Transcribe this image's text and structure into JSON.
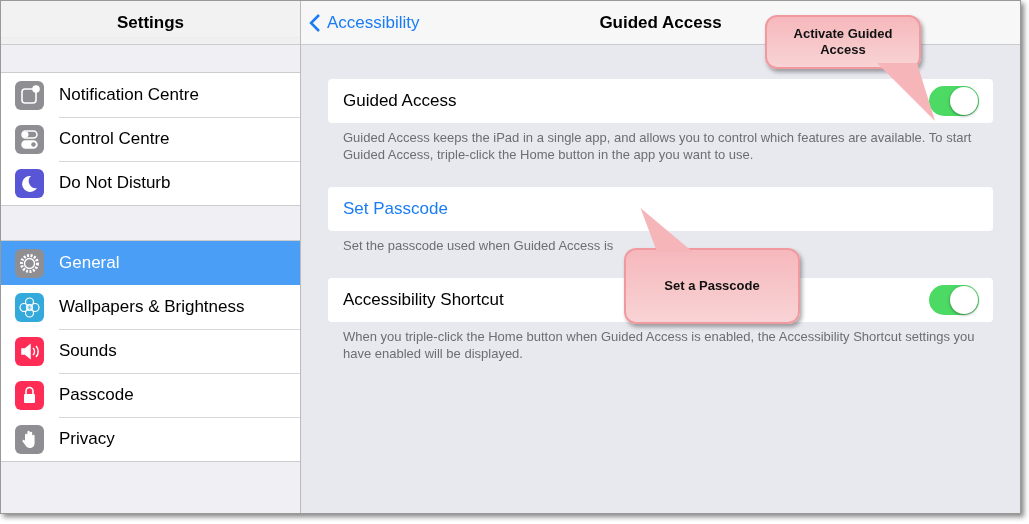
{
  "sidebar": {
    "title": "Settings",
    "groups": [
      [
        {
          "label": "Notification Centre",
          "selected": false
        },
        {
          "label": "Control Centre",
          "selected": false
        },
        {
          "label": "Do Not Disturb",
          "selected": false
        }
      ],
      [
        {
          "label": "General",
          "selected": true
        },
        {
          "label": "Wallpapers & Brightness",
          "selected": false
        },
        {
          "label": "Sounds",
          "selected": false
        },
        {
          "label": "Passcode",
          "selected": false
        },
        {
          "label": "Privacy",
          "selected": false
        }
      ]
    ]
  },
  "nav": {
    "back": "Accessibility",
    "title": "Guided Access"
  },
  "sections": [
    {
      "kind": "toggle",
      "label": "Guided Access",
      "on": true,
      "footer": "Guided Access keeps the iPad in a single app, and allows you to control which features are available. To start Guided Access, triple-click the Home button in the app you want to use."
    },
    {
      "kind": "link",
      "label": "Set Passcode",
      "footer": "Set the passcode used when Guided Access is"
    },
    {
      "kind": "toggle",
      "label": "Accessibility Shortcut",
      "on": true,
      "footer": "When you triple-click the Home button when Guided Access is enabled, the Accessibility Shortcut settings you have enabled will be displayed."
    }
  ],
  "callouts": [
    {
      "text": "Activate Guided Access"
    },
    {
      "text": "Set a Passcode"
    }
  ]
}
